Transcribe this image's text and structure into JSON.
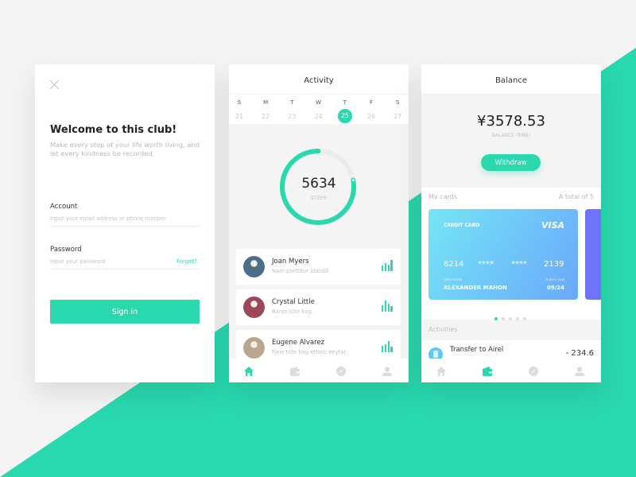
{
  "colors": {
    "accent": "#2ad8ad",
    "background": "#f4f4f4",
    "inactive_icon": "#dcdcdc",
    "card2": "#6f73fb"
  },
  "login": {
    "close_icon": "close-icon",
    "title": "Welcome to this club!",
    "subtitle": "Make every step of your life worth living, and let every kindness be recorded.",
    "account_label": "Account",
    "account_placeholder": "Input your email address or phone number",
    "password_label": "Password",
    "password_placeholder": "Input your password",
    "forget_link": "Forget?",
    "signin_button": "Sign in"
  },
  "activity": {
    "title": "Activity",
    "calendar": [
      {
        "dow": "S",
        "day": "21"
      },
      {
        "dow": "M",
        "day": "22"
      },
      {
        "dow": "T",
        "day": "23"
      },
      {
        "dow": "W",
        "day": "24"
      },
      {
        "dow": "T",
        "day": "25",
        "selected": true
      },
      {
        "dow": "F",
        "day": "26"
      },
      {
        "dow": "S",
        "day": "27"
      }
    ],
    "steps": "5634",
    "steps_label": "STEPS",
    "progress_fraction": 0.78,
    "people": [
      {
        "name": "Joan Myers",
        "desc": "Nam porttitor blandit",
        "avatar_color": "#4a6f86",
        "bars": [
          0.5,
          0.75,
          0.6,
          1.0
        ]
      },
      {
        "name": "Crystal Little",
        "desc": "Banjo tote bag.",
        "avatar_color": "#9e4758",
        "bars": [
          0.6,
          1.0,
          0.75,
          0.5
        ]
      },
      {
        "name": "Eugene Alvarez",
        "desc": "Fixie tote bag ethnic keytar.",
        "avatar_color": "#b8a690",
        "bars": [
          0.6,
          0.75,
          1.0,
          0.5
        ]
      }
    ],
    "tabs": [
      "home-icon",
      "wallet-icon",
      "compass-icon",
      "user-icon"
    ],
    "active_tab": 0
  },
  "balance": {
    "title": "Balance",
    "amount": "¥3578.53",
    "amount_label": "BALANCE (RMB)",
    "withdraw_button": "Withdraw",
    "my_cards_label": "My cards",
    "total_label": "A total of 5",
    "card": {
      "type": "CREDIT CARD",
      "brand": "VISA",
      "number_groups": [
        "6214",
        "****",
        "****",
        "2139"
      ],
      "holder_label": "CARD HOLDER",
      "holder": "ALEXANDER MAHON",
      "expiry_label": "MONTH / YEAR",
      "expiry": "09/24"
    },
    "card_count": 5,
    "active_card": 0,
    "activities_label": "Activities",
    "activity_item": {
      "name": "Transfer to Airel",
      "amount": "- 234.6"
    },
    "tabs": [
      "home-icon",
      "wallet-icon",
      "compass-icon",
      "user-icon"
    ],
    "active_tab": 1
  }
}
